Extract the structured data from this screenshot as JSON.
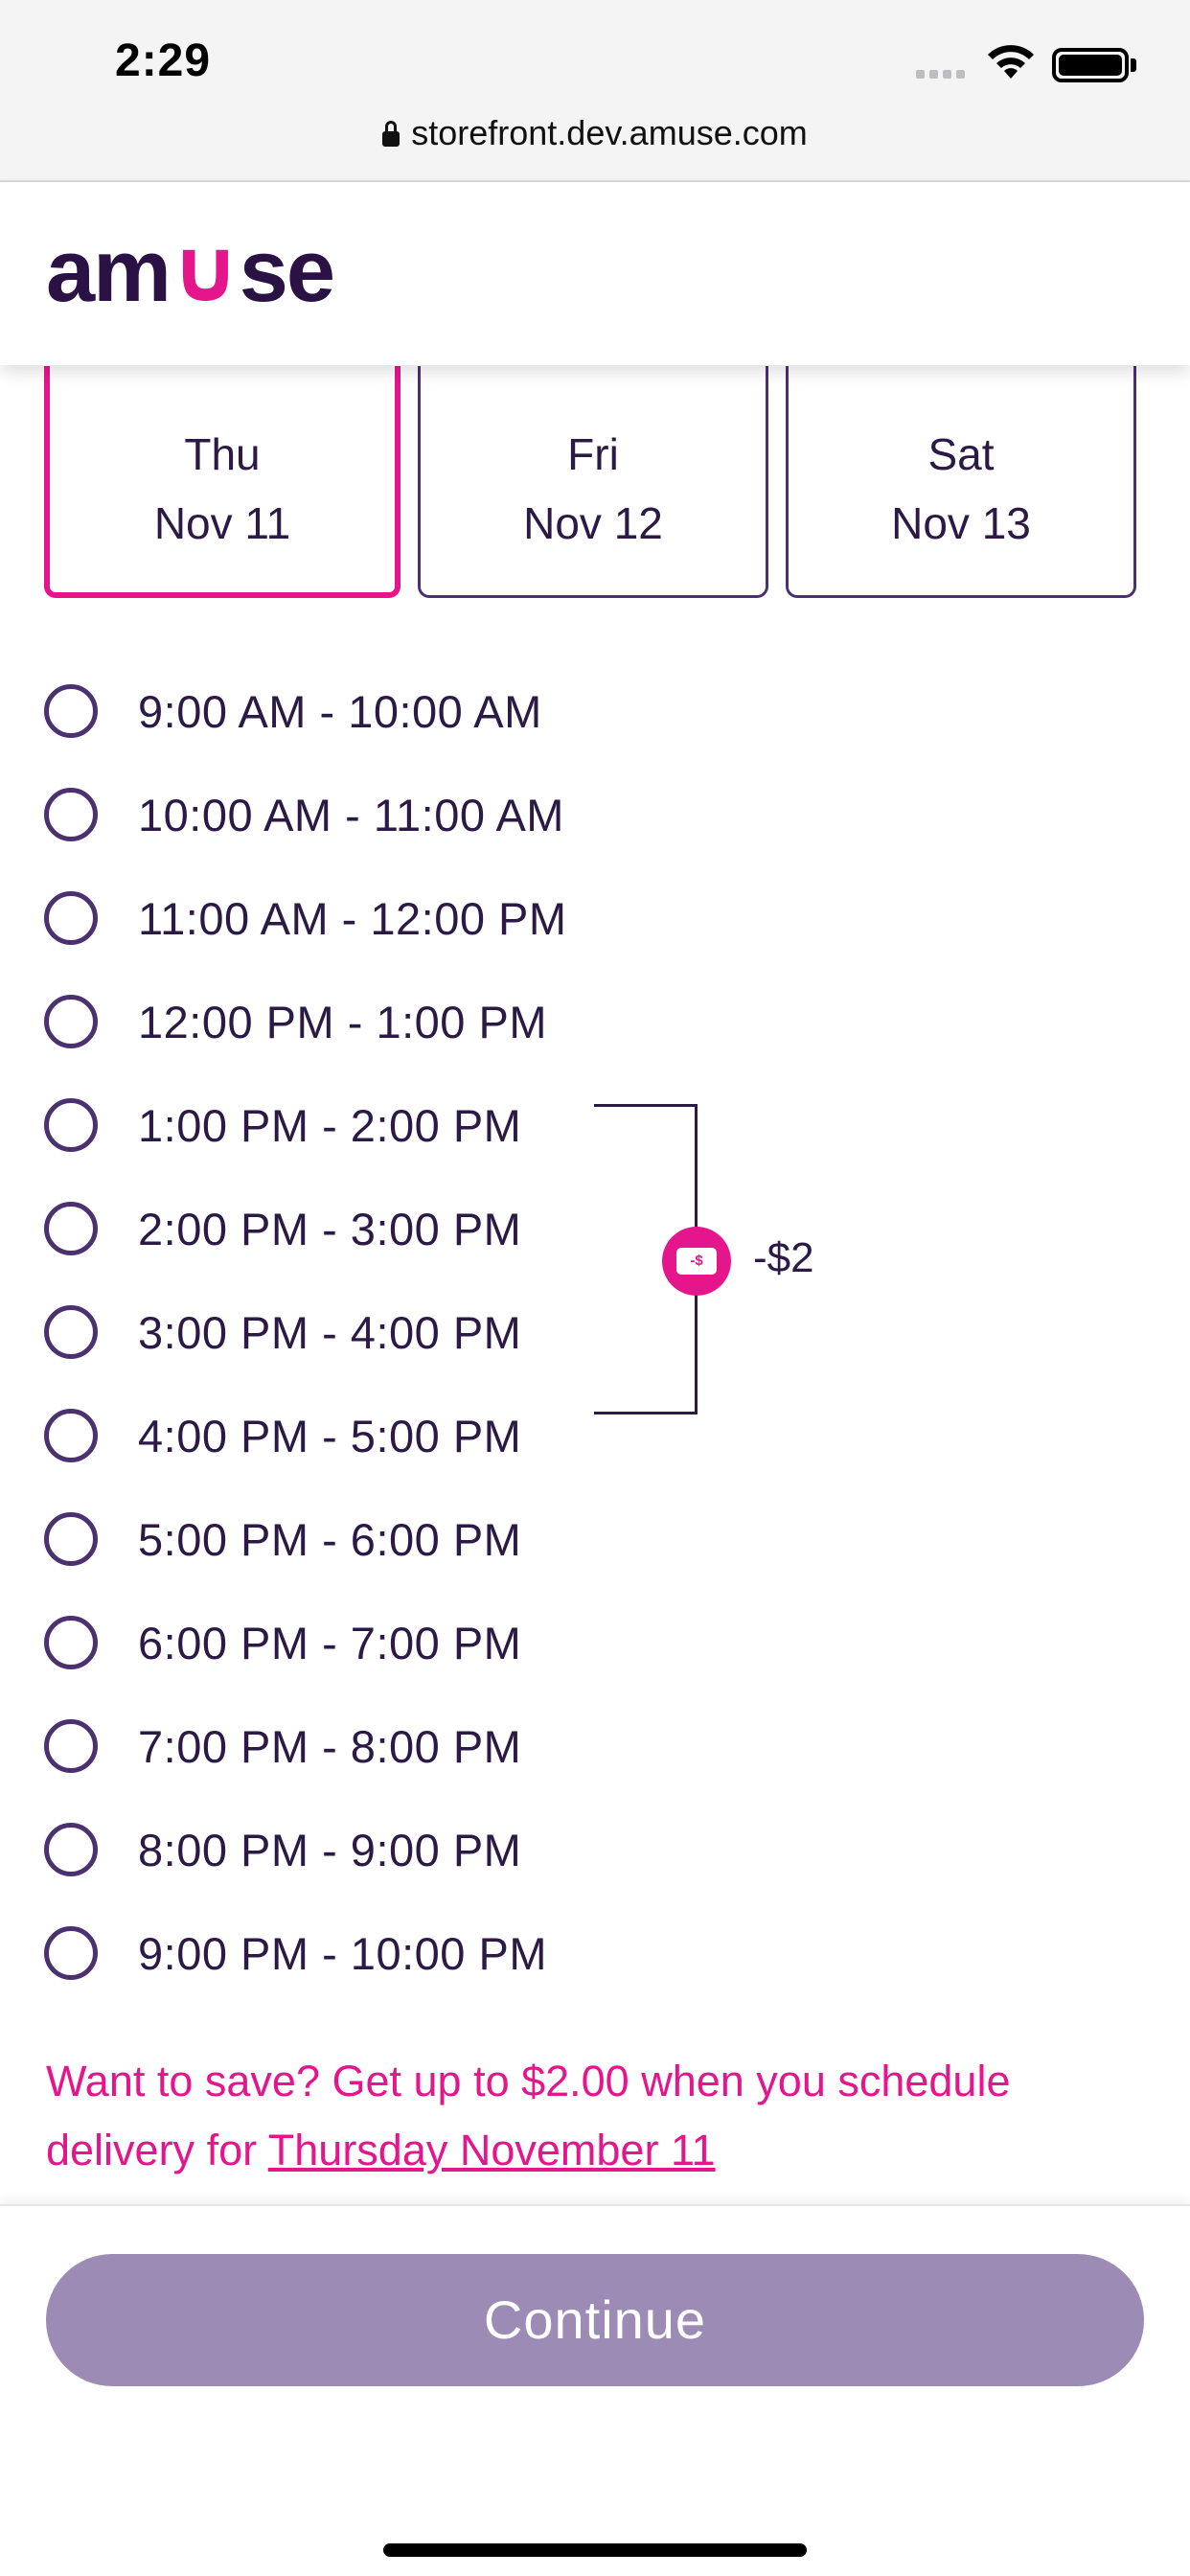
{
  "status_bar": {
    "time": "2:29"
  },
  "browser": {
    "url": "storefront.dev.amuse.com"
  },
  "header": {
    "logo_prefix": "am",
    "logo_u": "∪",
    "logo_suffix": "se"
  },
  "days": [
    {
      "weekday": "Thu",
      "date": "Nov 11",
      "selected": true
    },
    {
      "weekday": "Fri",
      "date": "Nov 12",
      "selected": false
    },
    {
      "weekday": "Sat",
      "date": "Nov 13",
      "selected": false
    }
  ],
  "slots": [
    "9:00 AM - 10:00 AM",
    "10:00 AM - 11:00 AM",
    "11:00 AM - 12:00 PM",
    "12:00 PM - 1:00 PM",
    "1:00 PM - 2:00 PM",
    "2:00 PM - 3:00 PM",
    "3:00 PM - 4:00 PM",
    "4:00 PM - 5:00 PM",
    "5:00 PM - 6:00 PM",
    "6:00 PM - 7:00 PM",
    "7:00 PM - 8:00 PM",
    "8:00 PM - 9:00 PM",
    "9:00 PM - 10:00 PM"
  ],
  "discount": {
    "badge_text": "-$",
    "label": "-$2"
  },
  "promo": {
    "text": "Want to save? Get up to $2.00 when you schedule delivery for ",
    "link": "Thursday November 11"
  },
  "footer": {
    "continue_label": "Continue"
  },
  "colors": {
    "accent": "#e5168c",
    "primary": "#4b3170",
    "button_disabled": "#9b8bb5"
  }
}
